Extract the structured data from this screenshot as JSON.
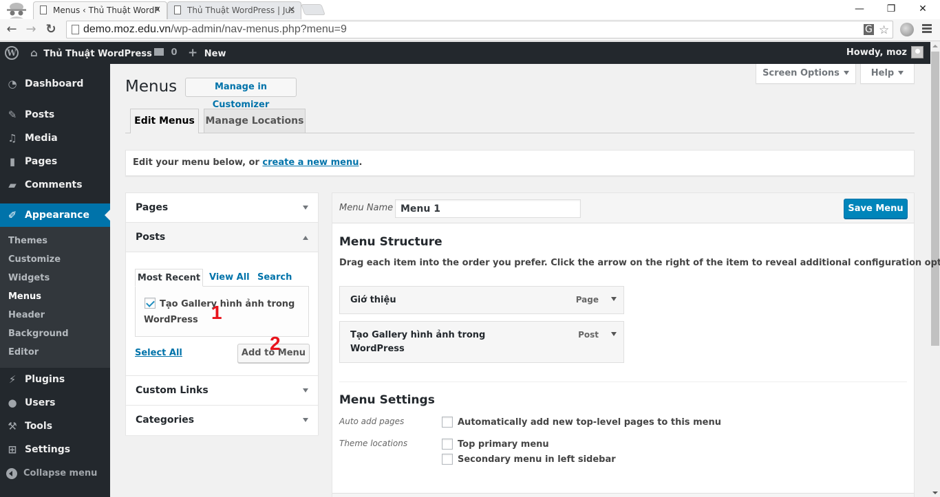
{
  "browser": {
    "tabs": [
      {
        "title": "Menus ‹ Thủ Thuật WordP",
        "active": true
      },
      {
        "title": "Thủ Thuật WordPress | Jus",
        "active": false
      }
    ],
    "url_host": "demo.moz.edu.vn",
    "url_path": "/wp-admin/nav-menus.php?menu=9",
    "window_controls": {
      "minimize": "—",
      "restore": "❐",
      "close": "✕"
    }
  },
  "adminbar": {
    "wp_logo": "W",
    "site_name": "Thủ Thuật WordPress",
    "comments_count": "0",
    "new_label": "New",
    "greeting": "Howdy, moz"
  },
  "sidebar": {
    "items": [
      {
        "label": "Dashboard",
        "icon": "dashboard-icon"
      },
      {
        "label": "Posts",
        "icon": "pin-icon"
      },
      {
        "label": "Media",
        "icon": "media-icon"
      },
      {
        "label": "Pages",
        "icon": "pages-icon"
      },
      {
        "label": "Comments",
        "icon": "comment-icon"
      },
      {
        "label": "Appearance",
        "icon": "brush-icon",
        "current": true
      },
      {
        "label": "Plugins",
        "icon": "plug-icon"
      },
      {
        "label": "Users",
        "icon": "user-icon"
      },
      {
        "label": "Tools",
        "icon": "wrench-icon"
      },
      {
        "label": "Settings",
        "icon": "settings-icon"
      }
    ],
    "submenu": [
      "Themes",
      "Customize",
      "Widgets",
      "Menus",
      "Header",
      "Background",
      "Editor"
    ],
    "submenu_current": "Menus",
    "collapse_label": "Collapse menu"
  },
  "header": {
    "title": "Menus",
    "customizer_button": "Manage in Customizer",
    "screen_options": "Screen Options",
    "help": "Help"
  },
  "nav_tabs": {
    "edit": "Edit Menus",
    "locations": "Manage Locations"
  },
  "notice": {
    "text": "Edit your menu below, or ",
    "link": "create a new menu",
    "suffix": "."
  },
  "left_panel": {
    "sections": {
      "pages": "Pages",
      "posts": "Posts",
      "custom_links": "Custom Links",
      "categories": "Categories"
    },
    "post_tabs": [
      "Most Recent",
      "View All",
      "Search"
    ],
    "post_items": [
      {
        "title": "Tạo Gallery hình ảnh trong WordPress",
        "checked": true
      }
    ],
    "select_all": "Select All",
    "add_to_menu": "Add to Menu",
    "annotations": [
      "1",
      "2"
    ]
  },
  "menu_editor": {
    "menu_name_label": "Menu Name",
    "menu_name_value": "Menu 1",
    "save_button": "Save Menu",
    "structure_title": "Menu Structure",
    "structure_desc": "Drag each item into the order you prefer. Click the arrow on the right of the item to reveal additional configuration options.",
    "items": [
      {
        "title": "Giớ thiệu",
        "type": "Page"
      },
      {
        "title": "Tạo Gallery hình ảnh trong WordPress",
        "type": "Post"
      }
    ],
    "settings_title": "Menu Settings",
    "auto_add_label": "Auto add pages",
    "auto_add_option": "Automatically add new top-level pages to this menu",
    "auto_add_checked": false,
    "locations_label": "Theme locations",
    "locations": [
      {
        "label": "Top primary menu",
        "checked": false
      },
      {
        "label": "Secondary menu in left sidebar",
        "checked": false
      }
    ]
  },
  "colors": {
    "accent": "#0073aa",
    "primary_button": "#0085ba",
    "sidebar_bg": "#23282d",
    "submenu_bg": "#32373c",
    "annotation": "#e8141c"
  }
}
